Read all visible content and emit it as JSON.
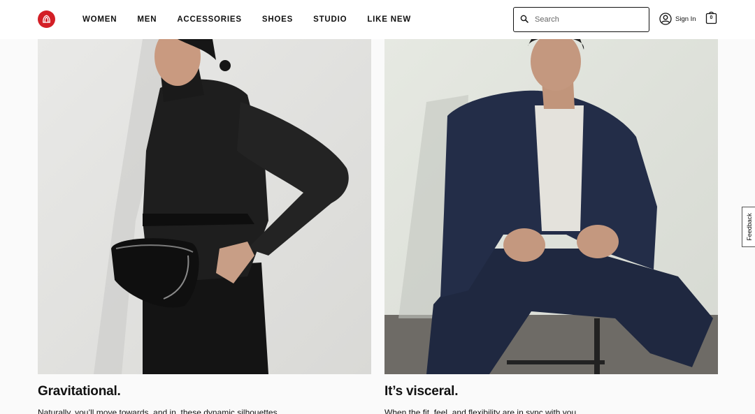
{
  "nav": {
    "items": [
      "WOMEN",
      "MEN",
      "ACCESSORIES",
      "SHOES",
      "STUDIO",
      "LIKE NEW"
    ]
  },
  "search": {
    "placeholder": "Search"
  },
  "account": {
    "signin_label": "Sign In"
  },
  "bag": {
    "count": "0"
  },
  "colors": {
    "brand": "#d31f26"
  },
  "cards": [
    {
      "title": "Gravitational.",
      "text": "Naturally, you’ll move towards, and in, these dynamic silhouettes."
    },
    {
      "title": "It’s visceral.",
      "text": "When the fit, feel, and flexibility are in sync with you."
    }
  ],
  "feedback": {
    "label": "Feedback"
  }
}
